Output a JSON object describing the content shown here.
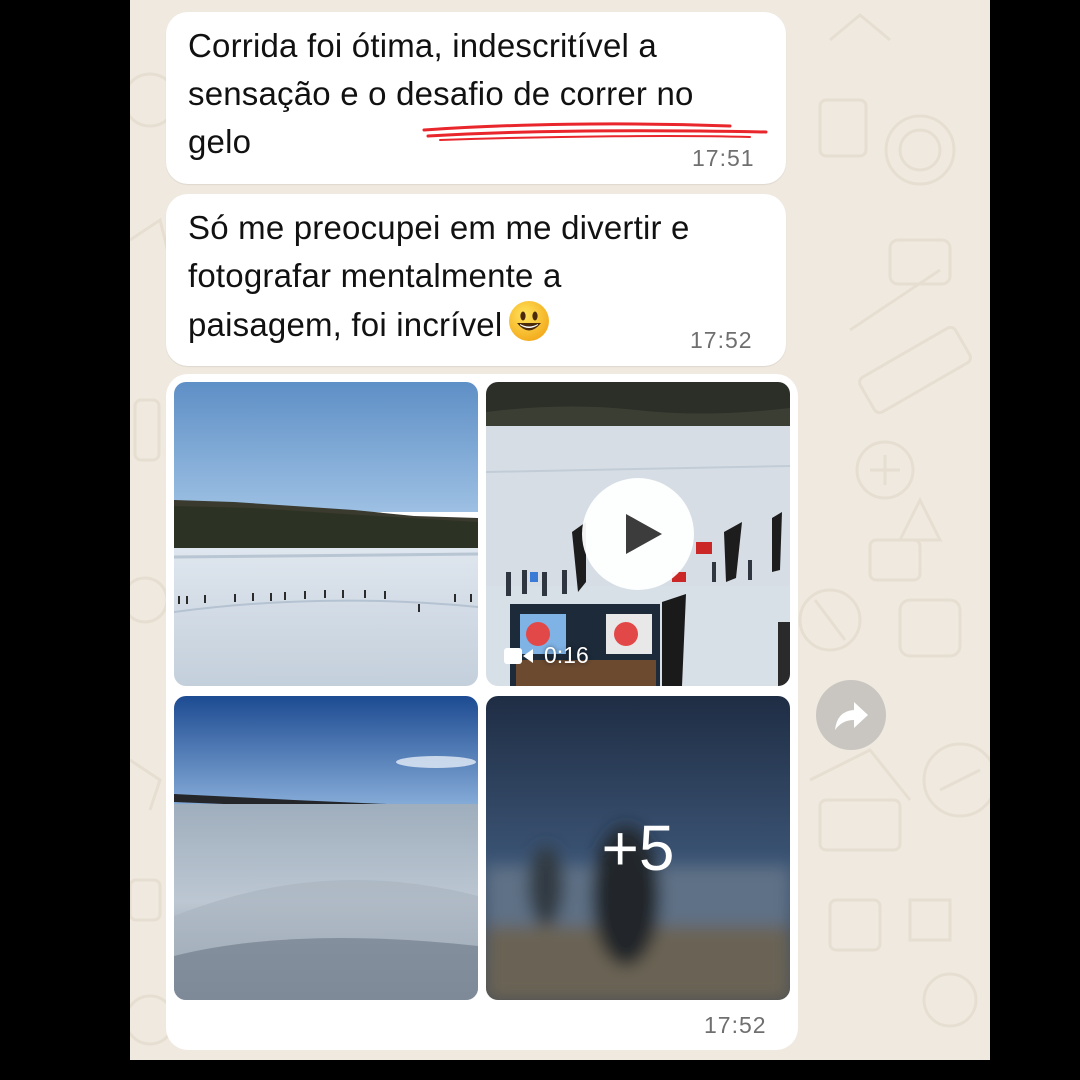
{
  "messages": [
    {
      "lines": [
        "Corrida foi ótima, indescritível a",
        "sensação e o desafio de correr no",
        "gelo"
      ],
      "time": "17:51"
    },
    {
      "lines": [
        "Só me preocupei em me divertir e",
        "fotografar mentalmente a",
        "paisagem, foi incrível"
      ],
      "emoji": "smiling-face-emoji",
      "time": "17:52"
    }
  ],
  "media_group": {
    "video_duration": "0:16",
    "more_count": "+5",
    "time": "17:52"
  },
  "icons": [
    "play-icon",
    "video-camera-icon",
    "forward-icon",
    "smiling-face-emoji"
  ],
  "colors": {
    "chat_background": "#efe9df",
    "bubble": "#ffffff",
    "underline_annotation": "#e8262b",
    "timestamp": "#6f6f6f"
  }
}
